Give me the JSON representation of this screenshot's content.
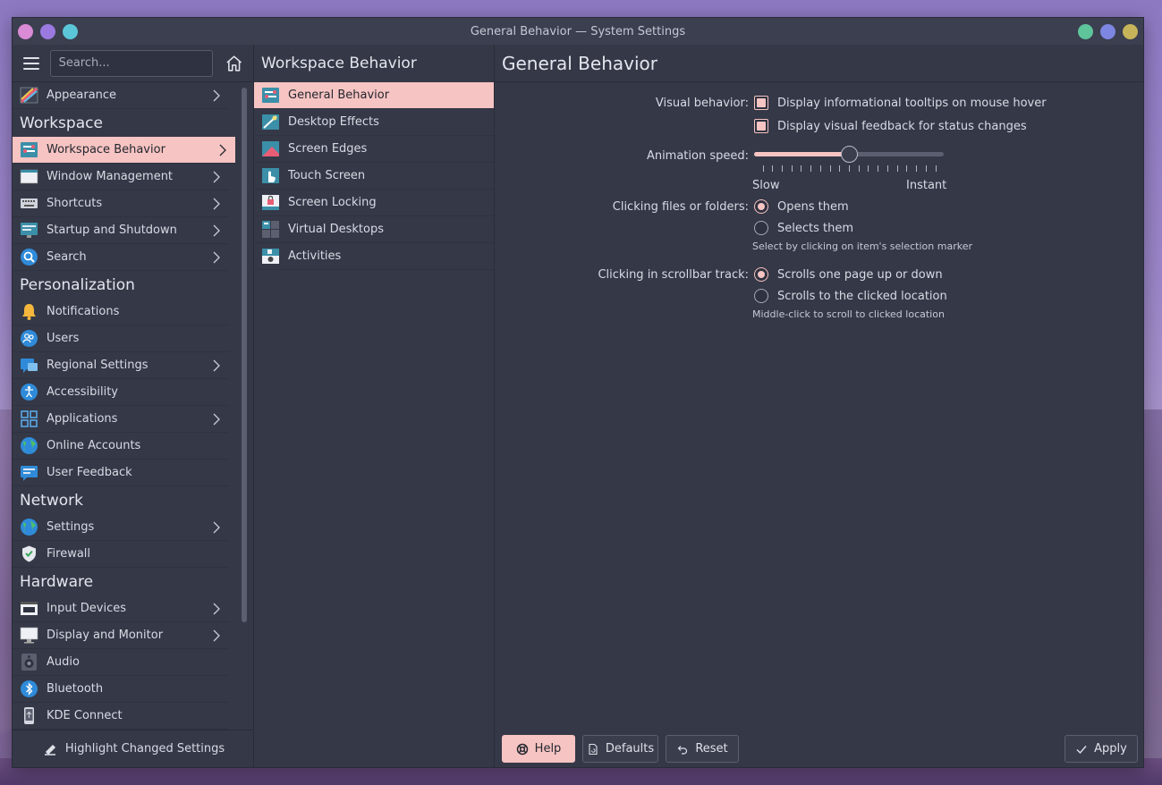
{
  "window": {
    "title": "General Behavior — System Settings",
    "left_dots": [
      "#d98bd6",
      "#9a7ae0",
      "#5bc6d8"
    ],
    "right_dots": [
      "#5fc39c",
      "#7d86e0",
      "#c7b45a"
    ]
  },
  "sidebar": {
    "search_placeholder": "Search...",
    "highlight_label": "Highlight Changed Settings",
    "entries": [
      {
        "kind": "item",
        "label": "Appearance",
        "icon": "appearance-icon",
        "chevron": true
      },
      {
        "kind": "section",
        "label": "Workspace"
      },
      {
        "kind": "item",
        "label": "Workspace Behavior",
        "icon": "workspace-behavior-icon",
        "chevron": true,
        "selected": true
      },
      {
        "kind": "item",
        "label": "Window Management",
        "icon": "window-management-icon",
        "chevron": true
      },
      {
        "kind": "item",
        "label": "Shortcuts",
        "icon": "keyboard-icon",
        "chevron": true
      },
      {
        "kind": "item",
        "label": "Startup and Shutdown",
        "icon": "startup-icon",
        "chevron": true
      },
      {
        "kind": "item",
        "label": "Search",
        "icon": "search-icon",
        "chevron": true
      },
      {
        "kind": "section",
        "label": "Personalization"
      },
      {
        "kind": "item",
        "label": "Notifications",
        "icon": "bell-icon",
        "chevron": false
      },
      {
        "kind": "item",
        "label": "Users",
        "icon": "users-icon",
        "chevron": false
      },
      {
        "kind": "item",
        "label": "Regional Settings",
        "icon": "regional-icon",
        "chevron": true
      },
      {
        "kind": "item",
        "label": "Accessibility",
        "icon": "accessibility-icon",
        "chevron": false
      },
      {
        "kind": "item",
        "label": "Applications",
        "icon": "applications-icon",
        "chevron": true
      },
      {
        "kind": "item",
        "label": "Online Accounts",
        "icon": "globe-icon",
        "chevron": false
      },
      {
        "kind": "item",
        "label": "User Feedback",
        "icon": "feedback-icon",
        "chevron": false
      },
      {
        "kind": "section",
        "label": "Network"
      },
      {
        "kind": "item",
        "label": "Settings",
        "icon": "network-globe-icon",
        "chevron": true
      },
      {
        "kind": "item",
        "label": "Firewall",
        "icon": "shield-icon",
        "chevron": false
      },
      {
        "kind": "section",
        "label": "Hardware"
      },
      {
        "kind": "item",
        "label": "Input Devices",
        "icon": "input-devices-icon",
        "chevron": true
      },
      {
        "kind": "item",
        "label": "Display and Monitor",
        "icon": "monitor-icon",
        "chevron": true
      },
      {
        "kind": "item",
        "label": "Audio",
        "icon": "speaker-icon",
        "chevron": false
      },
      {
        "kind": "item",
        "label": "Bluetooth",
        "icon": "bluetooth-icon",
        "chevron": false
      },
      {
        "kind": "item",
        "label": "KDE Connect",
        "icon": "phone-icon",
        "chevron": false
      }
    ]
  },
  "subcategories": {
    "title": "Workspace Behavior",
    "items": [
      {
        "label": "General Behavior",
        "icon": "general-behavior-icon",
        "selected": true
      },
      {
        "label": "Desktop Effects",
        "icon": "desktop-effects-icon"
      },
      {
        "label": "Screen Edges",
        "icon": "screen-edges-icon"
      },
      {
        "label": "Touch Screen",
        "icon": "touch-screen-icon"
      },
      {
        "label": "Screen Locking",
        "icon": "lock-icon"
      },
      {
        "label": "Virtual Desktops",
        "icon": "virtual-desktops-icon"
      },
      {
        "label": "Activities",
        "icon": "activities-icon"
      }
    ]
  },
  "page": {
    "title": "General Behavior",
    "visual": {
      "label": "Visual behavior:",
      "tooltips": "Display informational tooltips on mouse hover",
      "feedback": "Display visual feedback for status changes"
    },
    "animation": {
      "label": "Animation speed:",
      "slow": "Slow",
      "instant": "Instant",
      "value": 0.5,
      "ticks": 19
    },
    "clicking": {
      "label": "Clicking files or folders:",
      "opens": "Opens them",
      "selects": "Selects them",
      "hint": "Select by clicking on item's selection marker"
    },
    "scrollbar": {
      "label": "Clicking in scrollbar track:",
      "page": "Scrolls one page up or down",
      "location": "Scrolls to the clicked location",
      "hint": "Middle-click to scroll to clicked location"
    },
    "buttons": {
      "help": "Help",
      "defaults": "Defaults",
      "reset": "Reset",
      "apply": "Apply"
    }
  },
  "colors": {
    "accent": "#f6c4c2",
    "window_bg": "#353847"
  }
}
